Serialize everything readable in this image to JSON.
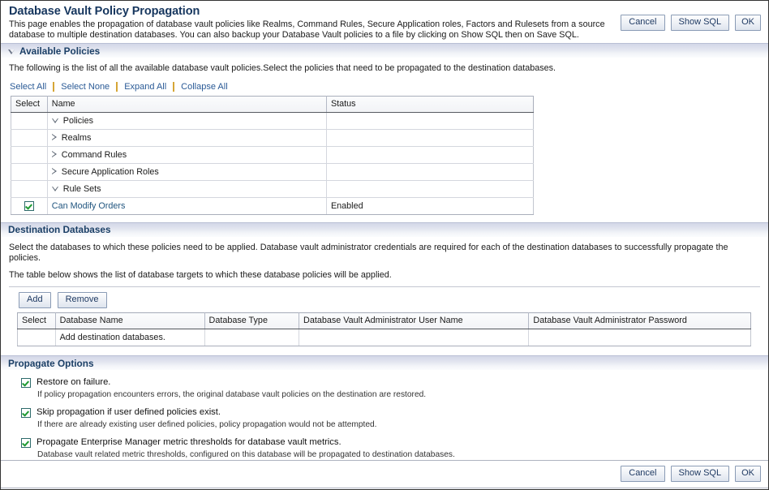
{
  "header": {
    "title": "Database Vault Policy Propagation",
    "description": "This page enables the propagation of database vault policies like Realms, Command Rules, Secure Application roles, Factors and Rulesets from a source database to multiple destination databases. You can also backup your Database Vault policies to a file by clicking on Show SQL then on Save SQL.",
    "buttons": {
      "cancel": "Cancel",
      "show_sql": "Show SQL",
      "ok": "OK"
    }
  },
  "available_policies": {
    "section_title": "Available Policies",
    "instruction": "The following is the list of all the available database vault policies.Select the policies that need to be propagated to the destination databases.",
    "links": {
      "select_all": "Select All",
      "select_none": "Select None",
      "expand_all": "Expand All",
      "collapse_all": "Collapse All"
    },
    "columns": {
      "select": "Select",
      "name": "Name",
      "status": "Status"
    },
    "rows": [
      {
        "name": "Policies",
        "status": "",
        "indent": 0,
        "toggle": "down",
        "checkbox": null,
        "link": false
      },
      {
        "name": "Realms",
        "status": "",
        "indent": 1,
        "toggle": "right",
        "checkbox": null,
        "link": false
      },
      {
        "name": "Command Rules",
        "status": "",
        "indent": 1,
        "toggle": "right",
        "checkbox": null,
        "link": false
      },
      {
        "name": "Secure Application Roles",
        "status": "",
        "indent": 1,
        "toggle": "right",
        "checkbox": null,
        "link": false
      },
      {
        "name": "Rule Sets",
        "status": "",
        "indent": 1,
        "toggle": "down",
        "checkbox": null,
        "link": false
      },
      {
        "name": "Can Modify Orders",
        "status": "Enabled",
        "indent": 2,
        "toggle": "none",
        "checkbox": true,
        "link": true
      }
    ]
  },
  "destination_databases": {
    "section_title": "Destination Databases",
    "paragraph_1": "Select the databases to which these policies need to be applied. Database vault administrator credentials are required for each of the destination databases to successfully propagate the policies.",
    "paragraph_2": "The table below shows the list of database targets to which these database policies will be applied.",
    "buttons": {
      "add": "Add",
      "remove": "Remove"
    },
    "columns": {
      "select": "Select",
      "database_name": "Database Name",
      "database_type": "Database Type",
      "admin_user": "Database Vault Administrator User Name",
      "admin_password": "Database Vault Administrator Password"
    },
    "empty_message": "Add destination databases."
  },
  "propagate_options": {
    "section_title": "Propagate Options",
    "options": [
      {
        "label": "Restore on failure.",
        "description": "If policy propagation encounters errors, the original database vault policies on the destination are restored.",
        "checked": true
      },
      {
        "label": "Skip propagation if user defined policies exist.",
        "description": "If there are already existing user defined policies, policy propagation would not be attempted.",
        "checked": true
      },
      {
        "label": "Propagate Enterprise Manager metric thresholds for database vault metrics.",
        "description": "Database vault related metric thresholds, configured on this database will be propagated to destination databases.",
        "checked": true
      }
    ]
  },
  "footer": {
    "buttons": {
      "cancel": "Cancel",
      "show_sql": "Show SQL",
      "ok": "OK"
    }
  },
  "colors": {
    "title_blue": "#16365e",
    "section_blue": "#1b3f66",
    "link_blue": "#2a5a96",
    "separator_gold": "#d6a636",
    "check_green": "#1e9a32"
  }
}
